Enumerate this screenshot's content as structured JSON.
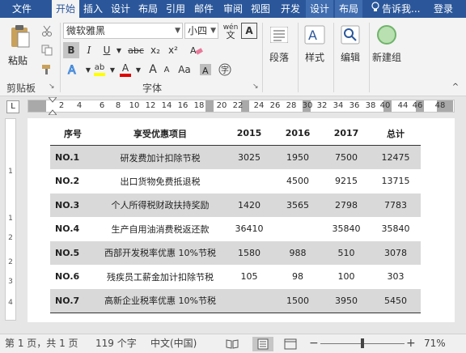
{
  "tabs": [
    "文件",
    "开始",
    "插入",
    "设计",
    "布局",
    "引用",
    "邮件",
    "审阅",
    "视图",
    "开发",
    "设计",
    "布局"
  ],
  "tell_me": "告诉我...",
  "login": "登录",
  "ribbon": {
    "paste": "粘贴",
    "clipboard": "剪贴板",
    "font_name": "微软雅黑",
    "font_size": "小四",
    "wen": "wén",
    "font_group": "字体",
    "bold": "B",
    "italic": "I",
    "underline": "U",
    "strike": "abc",
    "sub": "x₂",
    "sup": "x²",
    "grow": "A",
    "shrink": "A",
    "aa": "Aa",
    "char_border": "A",
    "paragraph": "段落",
    "styles": "样式",
    "editing": "编辑",
    "new_group": "新建组"
  },
  "ruler_numbers": [
    "2",
    "4",
    "6",
    "8",
    "10",
    "12",
    "14",
    "16",
    "18",
    "20",
    "22",
    "24",
    "26",
    "28",
    "30",
    "32",
    "34",
    "36",
    "38",
    "40",
    "44",
    "46",
    "48"
  ],
  "ruler_left_label": "L",
  "vruler_numbers": [
    "1",
    "1",
    "2",
    "2",
    "3",
    "4"
  ],
  "table": {
    "headers": [
      "序号",
      "享受优惠项目",
      "2015",
      "2016",
      "2017",
      "总计"
    ],
    "rows": [
      [
        "NO.1",
        "研发费加计扣除节税",
        "3025",
        "1950",
        "7500",
        "12475"
      ],
      [
        "NO.2",
        "出口货物免费抵退税",
        "",
        "4500",
        "9215",
        "13715"
      ],
      [
        "NO.3",
        "个人所得税财政扶持奖励",
        "1420",
        "3565",
        "2798",
        "7783"
      ],
      [
        "NO.4",
        "生产自用油消费税返还款",
        "36410",
        "",
        "35840",
        "35840"
      ],
      [
        "NO.5",
        "西部开发税率优惠 10%节税",
        "1580",
        "988",
        "510",
        "3078"
      ],
      [
        "NO.6",
        "残疾员工薪金加计扣除节税",
        "105",
        "98",
        "100",
        "303"
      ],
      [
        "NO.7",
        "高新企业税率优惠 10%节税",
        "",
        "1500",
        "3950",
        "5450"
      ]
    ]
  },
  "status": {
    "page": "第 1 页，共 1 页",
    "words": "119 个字",
    "lang": "中文(中国)",
    "zoom_minus": "−",
    "zoom_plus": "+",
    "zoom": "71%"
  },
  "colors": {
    "accent": "#2b579a",
    "highlight": "#ffff00",
    "font_red": "#e00000",
    "row_shade": "#d9d9d9"
  }
}
